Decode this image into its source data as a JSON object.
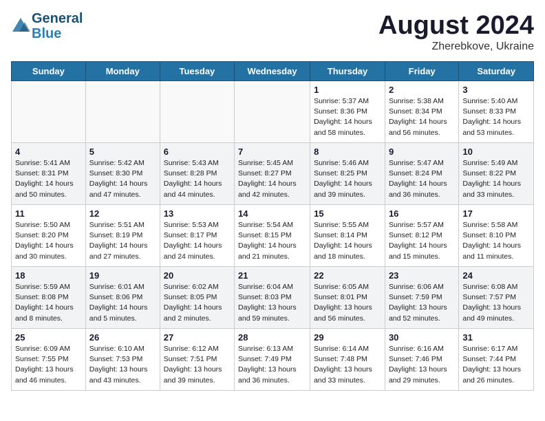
{
  "logo": {
    "line1": "General",
    "line2": "Blue"
  },
  "title": "August 2024",
  "subtitle": "Zherebkove, Ukraine",
  "days_header": [
    "Sunday",
    "Monday",
    "Tuesday",
    "Wednesday",
    "Thursday",
    "Friday",
    "Saturday"
  ],
  "weeks": [
    [
      {
        "day": "",
        "info": ""
      },
      {
        "day": "",
        "info": ""
      },
      {
        "day": "",
        "info": ""
      },
      {
        "day": "",
        "info": ""
      },
      {
        "day": "1",
        "info": "Sunrise: 5:37 AM\nSunset: 8:36 PM\nDaylight: 14 hours\nand 58 minutes."
      },
      {
        "day": "2",
        "info": "Sunrise: 5:38 AM\nSunset: 8:34 PM\nDaylight: 14 hours\nand 56 minutes."
      },
      {
        "day": "3",
        "info": "Sunrise: 5:40 AM\nSunset: 8:33 PM\nDaylight: 14 hours\nand 53 minutes."
      }
    ],
    [
      {
        "day": "4",
        "info": "Sunrise: 5:41 AM\nSunset: 8:31 PM\nDaylight: 14 hours\nand 50 minutes."
      },
      {
        "day": "5",
        "info": "Sunrise: 5:42 AM\nSunset: 8:30 PM\nDaylight: 14 hours\nand 47 minutes."
      },
      {
        "day": "6",
        "info": "Sunrise: 5:43 AM\nSunset: 8:28 PM\nDaylight: 14 hours\nand 44 minutes."
      },
      {
        "day": "7",
        "info": "Sunrise: 5:45 AM\nSunset: 8:27 PM\nDaylight: 14 hours\nand 42 minutes."
      },
      {
        "day": "8",
        "info": "Sunrise: 5:46 AM\nSunset: 8:25 PM\nDaylight: 14 hours\nand 39 minutes."
      },
      {
        "day": "9",
        "info": "Sunrise: 5:47 AM\nSunset: 8:24 PM\nDaylight: 14 hours\nand 36 minutes."
      },
      {
        "day": "10",
        "info": "Sunrise: 5:49 AM\nSunset: 8:22 PM\nDaylight: 14 hours\nand 33 minutes."
      }
    ],
    [
      {
        "day": "11",
        "info": "Sunrise: 5:50 AM\nSunset: 8:20 PM\nDaylight: 14 hours\nand 30 minutes."
      },
      {
        "day": "12",
        "info": "Sunrise: 5:51 AM\nSunset: 8:19 PM\nDaylight: 14 hours\nand 27 minutes."
      },
      {
        "day": "13",
        "info": "Sunrise: 5:53 AM\nSunset: 8:17 PM\nDaylight: 14 hours\nand 24 minutes."
      },
      {
        "day": "14",
        "info": "Sunrise: 5:54 AM\nSunset: 8:15 PM\nDaylight: 14 hours\nand 21 minutes."
      },
      {
        "day": "15",
        "info": "Sunrise: 5:55 AM\nSunset: 8:14 PM\nDaylight: 14 hours\nand 18 minutes."
      },
      {
        "day": "16",
        "info": "Sunrise: 5:57 AM\nSunset: 8:12 PM\nDaylight: 14 hours\nand 15 minutes."
      },
      {
        "day": "17",
        "info": "Sunrise: 5:58 AM\nSunset: 8:10 PM\nDaylight: 14 hours\nand 11 minutes."
      }
    ],
    [
      {
        "day": "18",
        "info": "Sunrise: 5:59 AM\nSunset: 8:08 PM\nDaylight: 14 hours\nand 8 minutes."
      },
      {
        "day": "19",
        "info": "Sunrise: 6:01 AM\nSunset: 8:06 PM\nDaylight: 14 hours\nand 5 minutes."
      },
      {
        "day": "20",
        "info": "Sunrise: 6:02 AM\nSunset: 8:05 PM\nDaylight: 14 hours\nand 2 minutes."
      },
      {
        "day": "21",
        "info": "Sunrise: 6:04 AM\nSunset: 8:03 PM\nDaylight: 13 hours\nand 59 minutes."
      },
      {
        "day": "22",
        "info": "Sunrise: 6:05 AM\nSunset: 8:01 PM\nDaylight: 13 hours\nand 56 minutes."
      },
      {
        "day": "23",
        "info": "Sunrise: 6:06 AM\nSunset: 7:59 PM\nDaylight: 13 hours\nand 52 minutes."
      },
      {
        "day": "24",
        "info": "Sunrise: 6:08 AM\nSunset: 7:57 PM\nDaylight: 13 hours\nand 49 minutes."
      }
    ],
    [
      {
        "day": "25",
        "info": "Sunrise: 6:09 AM\nSunset: 7:55 PM\nDaylight: 13 hours\nand 46 minutes."
      },
      {
        "day": "26",
        "info": "Sunrise: 6:10 AM\nSunset: 7:53 PM\nDaylight: 13 hours\nand 43 minutes."
      },
      {
        "day": "27",
        "info": "Sunrise: 6:12 AM\nSunset: 7:51 PM\nDaylight: 13 hours\nand 39 minutes."
      },
      {
        "day": "28",
        "info": "Sunrise: 6:13 AM\nSunset: 7:49 PM\nDaylight: 13 hours\nand 36 minutes."
      },
      {
        "day": "29",
        "info": "Sunrise: 6:14 AM\nSunset: 7:48 PM\nDaylight: 13 hours\nand 33 minutes."
      },
      {
        "day": "30",
        "info": "Sunrise: 6:16 AM\nSunset: 7:46 PM\nDaylight: 13 hours\nand 29 minutes."
      },
      {
        "day": "31",
        "info": "Sunrise: 6:17 AM\nSunset: 7:44 PM\nDaylight: 13 hours\nand 26 minutes."
      }
    ]
  ]
}
